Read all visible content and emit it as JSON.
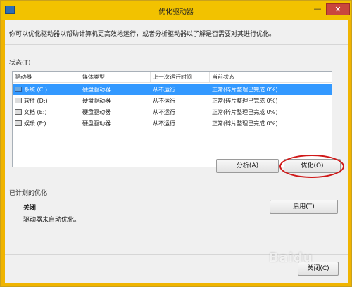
{
  "window": {
    "title": "优化驱动器",
    "minimize_glyph": "—",
    "close_glyph": "✕"
  },
  "intro": "你可以优化驱动器以帮助计算机更高效地运行，或者分析驱动器以了解是否需要对其进行优化。",
  "status_section": {
    "label": "状态(T)",
    "columns": [
      "驱动器",
      "媒体类型",
      "上一次运行时间",
      "当前状态"
    ],
    "rows": [
      {
        "drive": "系统 (C:)",
        "media": "硬盘驱动器",
        "last_run": "从不运行",
        "status": "正常(碎片整理已完成 0%)",
        "icon": "windows-drive-icon",
        "selected": true
      },
      {
        "drive": "软件 (D:)",
        "media": "硬盘驱动器",
        "last_run": "从不运行",
        "status": "正常(碎片整理已完成 0%)",
        "icon": "drive-icon",
        "selected": false
      },
      {
        "drive": "文档 (E:)",
        "media": "硬盘驱动器",
        "last_run": "从不运行",
        "status": "正常(碎片整理已完成 0%)",
        "icon": "drive-icon",
        "selected": false
      },
      {
        "drive": "娱乐 (F:)",
        "media": "硬盘驱动器",
        "last_run": "从不运行",
        "status": "正常(碎片整理已完成 0%)",
        "icon": "drive-icon",
        "selected": false
      }
    ]
  },
  "actions": {
    "analyze": "分析(A)",
    "optimize": "优化(O)"
  },
  "scheduled": {
    "label": "已计划的优化",
    "state": "关闭",
    "description": "驱动器未自动优化。",
    "enable": "启用(T)"
  },
  "footer": {
    "close": "关闭(C)"
  },
  "watermark": "Baidu",
  "colors": {
    "selection": "#3399ff",
    "frame": "#f2c200",
    "highlight_ring": "#d01818"
  }
}
